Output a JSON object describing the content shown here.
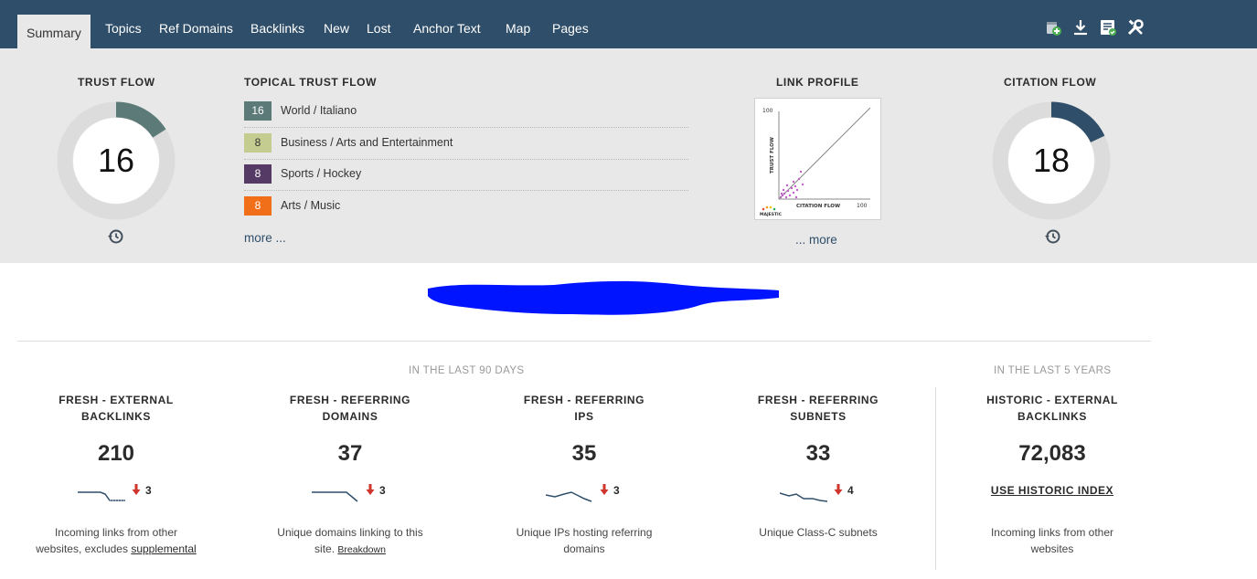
{
  "nav": {
    "tabs": [
      {
        "label": "Summary",
        "active": true
      },
      {
        "label": "Topics"
      },
      {
        "label": "Ref Domains"
      },
      {
        "label": "Backlinks"
      },
      {
        "label": "New"
      },
      {
        "label": "Lost"
      },
      {
        "label": "Anchor Text"
      },
      {
        "label": "Map"
      },
      {
        "label": "Pages"
      }
    ],
    "tools": [
      "add-to-bucket-icon",
      "download-icon",
      "report-icon",
      "tools-icon"
    ],
    "bar_color": "#2f4e6a"
  },
  "summary": {
    "trust_flow": {
      "title": "TRUST FLOW",
      "value": "16",
      "level": 0.16,
      "color": "#5b7a78"
    },
    "topical_trust_flow": {
      "title": "TOPICAL TRUST FLOW",
      "items": [
        {
          "value": "16",
          "label": "World / Italiano",
          "color": "#5b7a78"
        },
        {
          "value": "8",
          "label": "Business / Arts and Entertainment",
          "color": "#c5cc90"
        },
        {
          "value": "8",
          "label": "Sports / Hockey",
          "color": "#553a66"
        },
        {
          "value": "8",
          "label": "Arts / Music",
          "color": "#f26f1a"
        }
      ],
      "more": "more ..."
    },
    "link_profile": {
      "title": "LINK PROFILE",
      "y_axis_label": "TRUST FLOW",
      "x_axis_label": "CITATION FLOW",
      "y_max_label": "100",
      "x_max_label": "100",
      "brand": "MAJESTIC",
      "more": "... more"
    },
    "citation_flow": {
      "title": "CITATION FLOW",
      "value": "18",
      "level": 0.18,
      "color": "#2f4e6a"
    }
  },
  "stats": {
    "period_recent": "IN THE LAST 90 DAYS",
    "period_historic": "IN THE LAST 5 YEARS",
    "fresh_backlinks": {
      "title_line1": "FRESH - EXTERNAL",
      "title_line2": "BACKLINKS",
      "value": "210",
      "delta": "3",
      "desc_line1": "Incoming links from other",
      "desc_line2": "websites, excludes",
      "link": "supplemental"
    },
    "fresh_domains": {
      "title_line1": "FRESH - REFERRING",
      "title_line2": "DOMAINS",
      "value": "37",
      "delta": "3",
      "desc_line1": "Unique domains linking to this",
      "desc_line2": "site.",
      "link": "Breakdown"
    },
    "fresh_ips": {
      "title_line1": "FRESH - REFERRING",
      "title_line2": "IPS",
      "value": "35",
      "delta": "3",
      "desc_line1": "Unique IPs hosting referring",
      "desc_line2": "domains"
    },
    "fresh_subnets": {
      "title_line1": "FRESH - REFERRING",
      "title_line2": "SUBNETS",
      "value": "33",
      "delta": "4",
      "desc_line1": "Unique Class-C subnets"
    },
    "historic_backlinks": {
      "title_line1": "HISTORIC - EXTERNAL",
      "title_line2": "BACKLINKS",
      "value": "72,083",
      "link": "USE HISTORIC INDEX",
      "desc_line1": "Incoming links from other",
      "desc_line2": "websites"
    }
  }
}
